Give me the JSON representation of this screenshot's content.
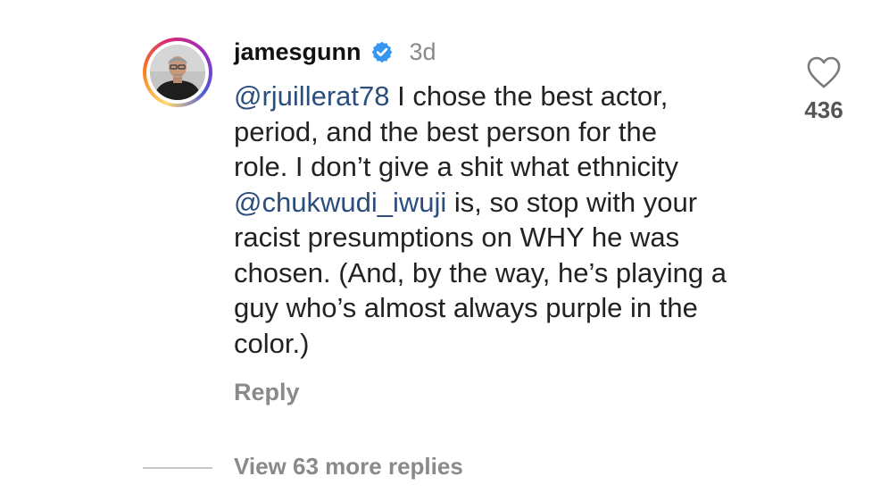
{
  "comment": {
    "username": "jamesgunn",
    "time": "3d",
    "verified": true,
    "avatar_icon": "profile-photo",
    "body": {
      "line1_mention": "@rjuillerat78",
      "line1_text": " I chose the best actor,",
      "line2": "period, and the best person for the",
      "line3": "role. I don’t give a shit what ethnicity",
      "line4_mention": "@chukwudi_iwuji",
      "line4_text": " is, so stop with your",
      "line5": "racist presumptions on WHY he was",
      "line6": "chosen. (And, by the way, he’s playing a",
      "line7": "guy who’s almost always purple in the",
      "line8": "color.)"
    },
    "reply_label": "Reply",
    "likes": "436",
    "view_replies_label": "View 63 more replies"
  },
  "colors": {
    "mention": "#2b4e7c",
    "verified_badge": "#3797f0",
    "muted_text": "#8a8a8a"
  }
}
